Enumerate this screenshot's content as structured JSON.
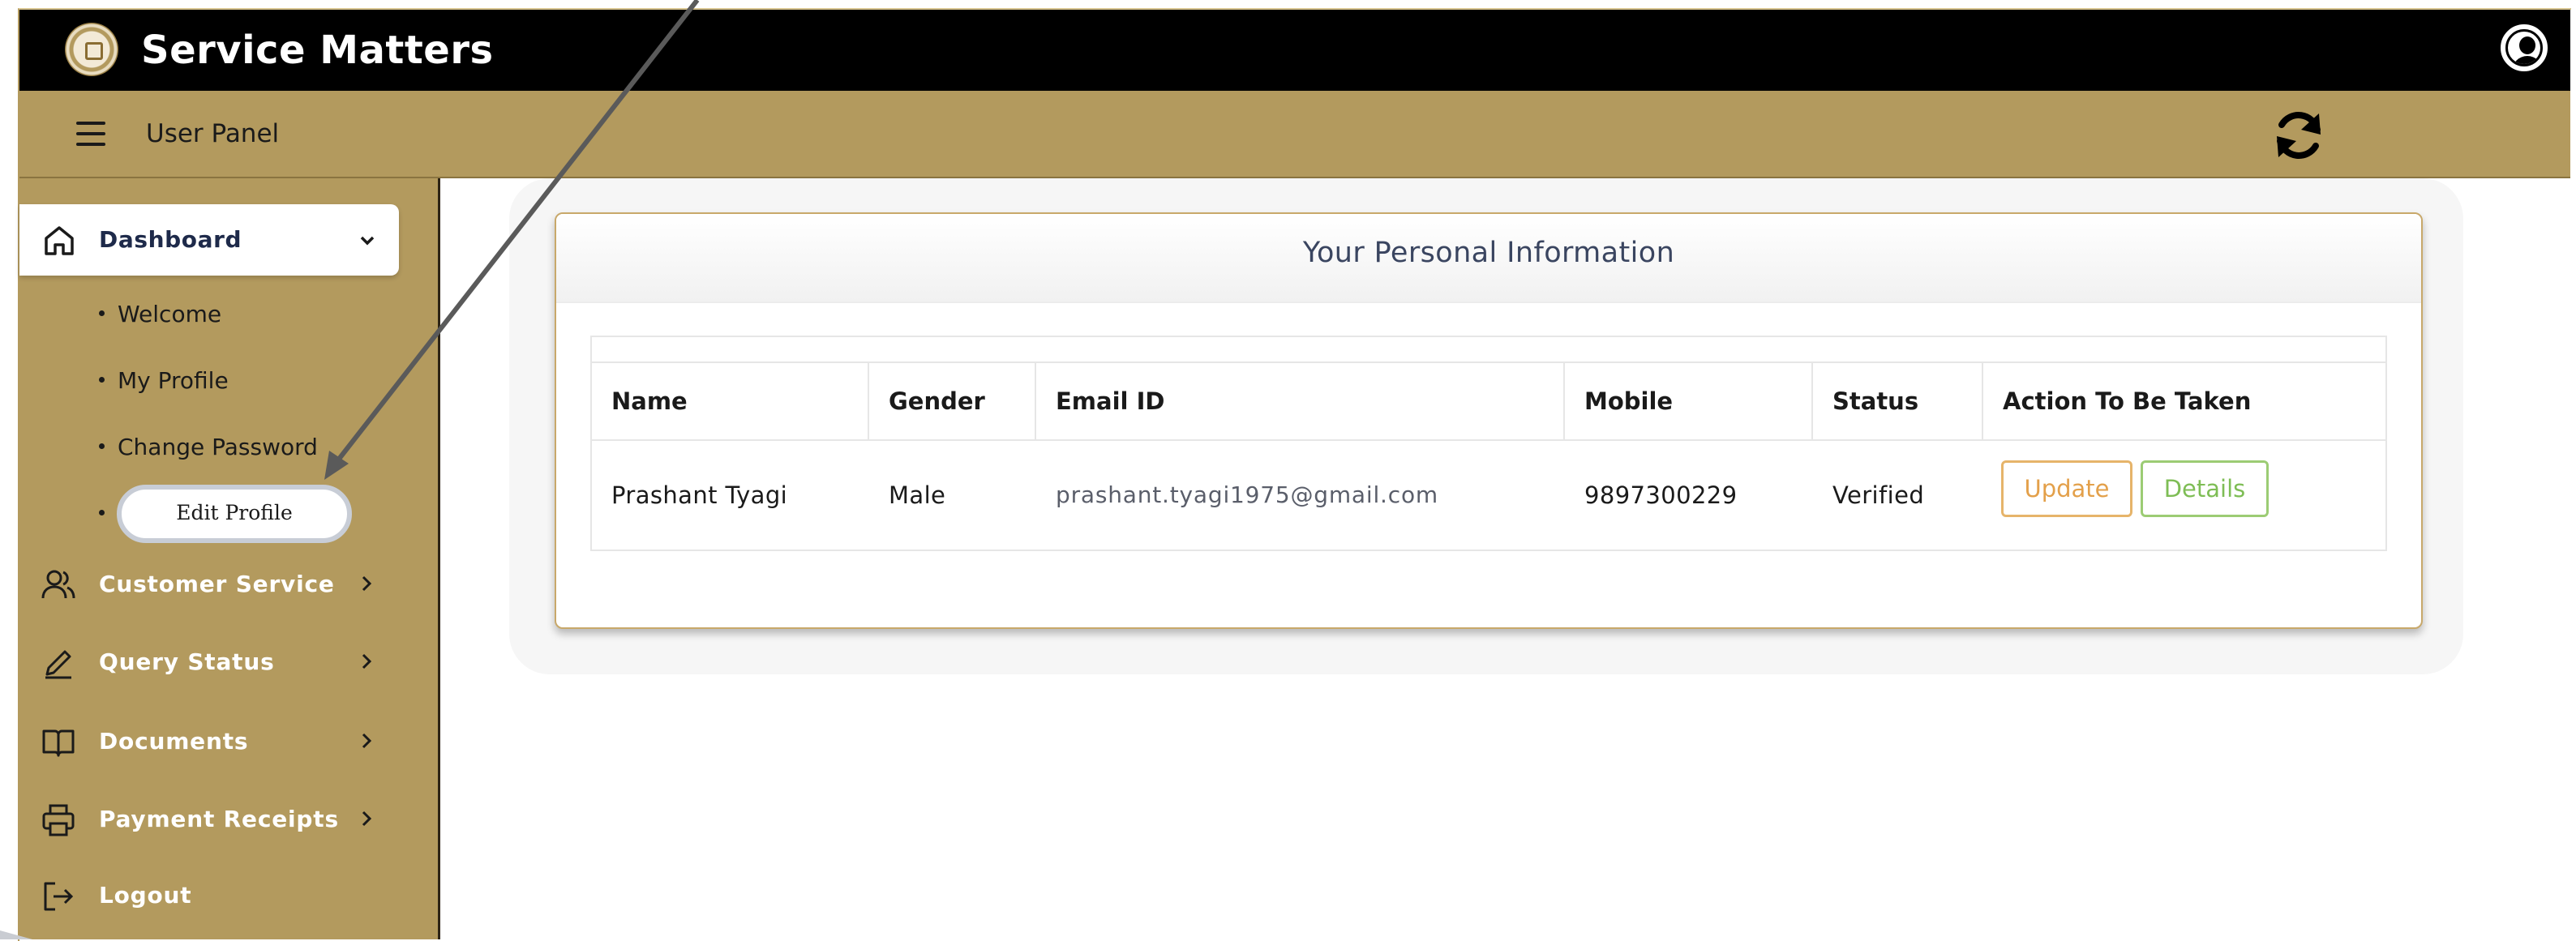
{
  "header": {
    "app_title": "Service Matters",
    "panel_label": "User Panel"
  },
  "sidebar": {
    "dashboard_label": "Dashboard",
    "sub_items": [
      "Welcome",
      "My Profile",
      "Change Password",
      "Edit Profile"
    ],
    "items": [
      {
        "label": "Customer Service",
        "icon": "users-icon"
      },
      {
        "label": "Query Status",
        "icon": "pen-icon"
      },
      {
        "label": "Documents",
        "icon": "book-icon"
      },
      {
        "label": "Payment Receipts",
        "icon": "printer-icon"
      },
      {
        "label": "Logout",
        "icon": "logout-icon"
      }
    ]
  },
  "card": {
    "title": "Your Personal Information",
    "columns": [
      "Name",
      "Gender",
      "Email ID",
      "Mobile",
      "Status",
      "Action To Be Taken"
    ],
    "row": {
      "name": "Prashant Tyagi",
      "gender": "Male",
      "email": "prashant.tyagi1975@gmail.com",
      "mobile": "9897300229",
      "status": "Verified"
    },
    "actions": {
      "update": "Update",
      "details": "Details"
    }
  },
  "colors": {
    "header_bg": "#000000",
    "gold": "#b39a5e",
    "update_btn": "#e3a04a",
    "details_btn": "#7ebd55"
  }
}
